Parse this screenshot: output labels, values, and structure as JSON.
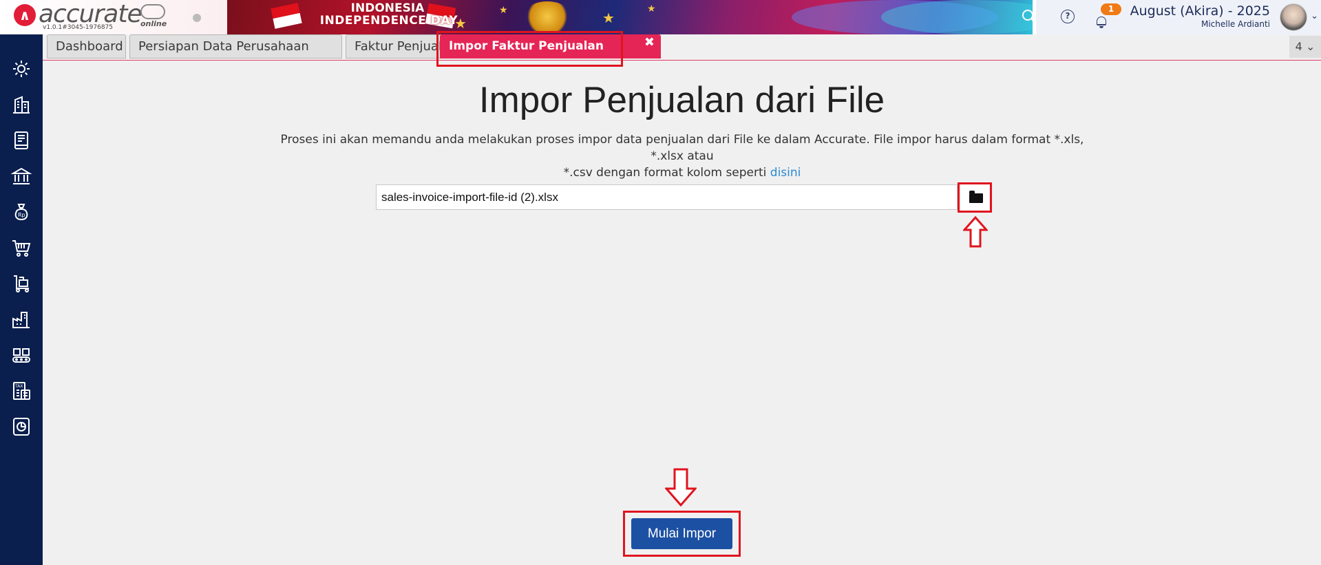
{
  "app": {
    "logo_text": "accurate",
    "logo_sub": "online",
    "version": "v1.0.1#3045-1976875"
  },
  "banner": {
    "line1": "INDONESIA",
    "line2": "INDEPENDENCE DAY"
  },
  "header": {
    "notification_count": "1",
    "company": "August (Akira) - 2025",
    "user": "Michelle Ardianti",
    "help_glyph": "?",
    "chevron": "⌄"
  },
  "sidebar": {
    "items": [
      {
        "icon": "gear-icon"
      },
      {
        "icon": "building-icon"
      },
      {
        "icon": "ledger-icon"
      },
      {
        "icon": "bank-icon"
      },
      {
        "icon": "money-bag-icon"
      },
      {
        "icon": "cart-icon"
      },
      {
        "icon": "trolley-icon"
      },
      {
        "icon": "factory-icon"
      },
      {
        "icon": "conveyor-icon"
      },
      {
        "icon": "tax-icon"
      },
      {
        "icon": "report-icon"
      }
    ]
  },
  "tabs": [
    {
      "label": "Dashboard",
      "closable": false,
      "active": false
    },
    {
      "label": "Persiapan Data Perusahaan",
      "closable": false,
      "active": false
    },
    {
      "label": "Faktur Penjualan",
      "closable": true,
      "active": false
    },
    {
      "label": "Impor Faktur Penjualan",
      "closable": true,
      "active": true
    }
  ],
  "tab_count": "4",
  "main": {
    "title": "Impor Penjualan dari File",
    "description_line1": "Proses ini akan memandu anda melakukan proses impor data penjualan dari File ke dalam Accurate. File impor harus dalam format *.xls, *.xlsx atau",
    "description_line2": "*.csv dengan format kolom seperti",
    "link_text": "disini",
    "file_value": "sales-invoice-import-file-id (2).xlsx",
    "start_button": "Mulai Impor"
  },
  "colors": {
    "sidebar": "#0a1f4e",
    "active_tab": "#e52556",
    "primary_button": "#1c50a3",
    "highlight": "#e0141e",
    "link": "#2a8ad4"
  }
}
